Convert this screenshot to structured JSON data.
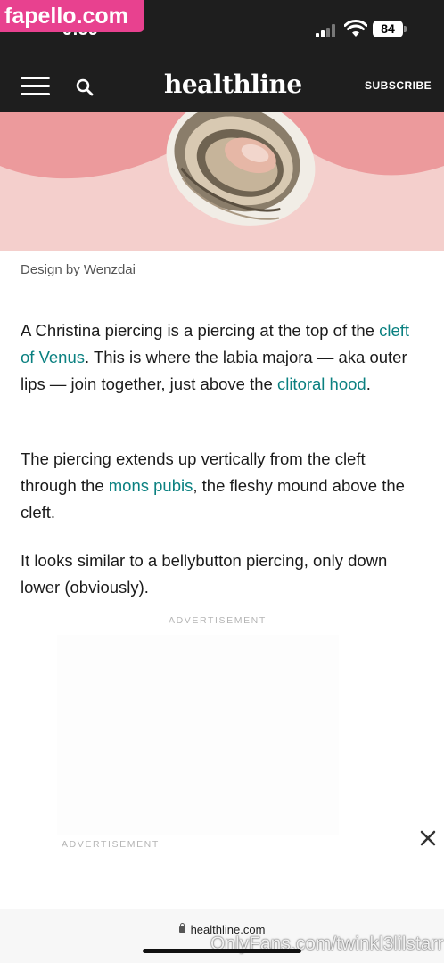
{
  "status": {
    "time": "9:39",
    "battery": "84"
  },
  "watermarks": {
    "top": "fapello.com",
    "bottom": "OnlyFans.com/twinkl3lilstarr"
  },
  "header": {
    "logo": "healthline",
    "subscribe": "SUBSCRIBE",
    "menu_icon": "hamburger-icon",
    "search_icon": "search-icon"
  },
  "hero": {
    "caption": "Design by Wenzdai",
    "bg_color": "#f4cfcc"
  },
  "article": {
    "p1": {
      "t1": "A Christina piercing is a piercing at the top of the ",
      "l1": "cleft of Venus",
      "t2": ". This is where the labia majora — aka outer lips — join together, just above the ",
      "l2": "clitoral hood",
      "t3": "."
    },
    "p2": {
      "t1": "The piercing extends up vertically from the cleft through the ",
      "l1": "mons pubis",
      "t2": ", the fleshy mound above the cleft."
    },
    "p3": "It looks similar to a bellybutton piercing, only down lower (obviously)."
  },
  "ads": {
    "label_1": "ADVERTISEMENT",
    "label_2": "ADVERTISEMENT",
    "close_icon": "close-icon"
  },
  "browser": {
    "url": "healthline.com"
  },
  "colors": {
    "header_bg": "#1e1e1e",
    "link": "#0a8080",
    "watermark_pink": "#e8418f"
  }
}
